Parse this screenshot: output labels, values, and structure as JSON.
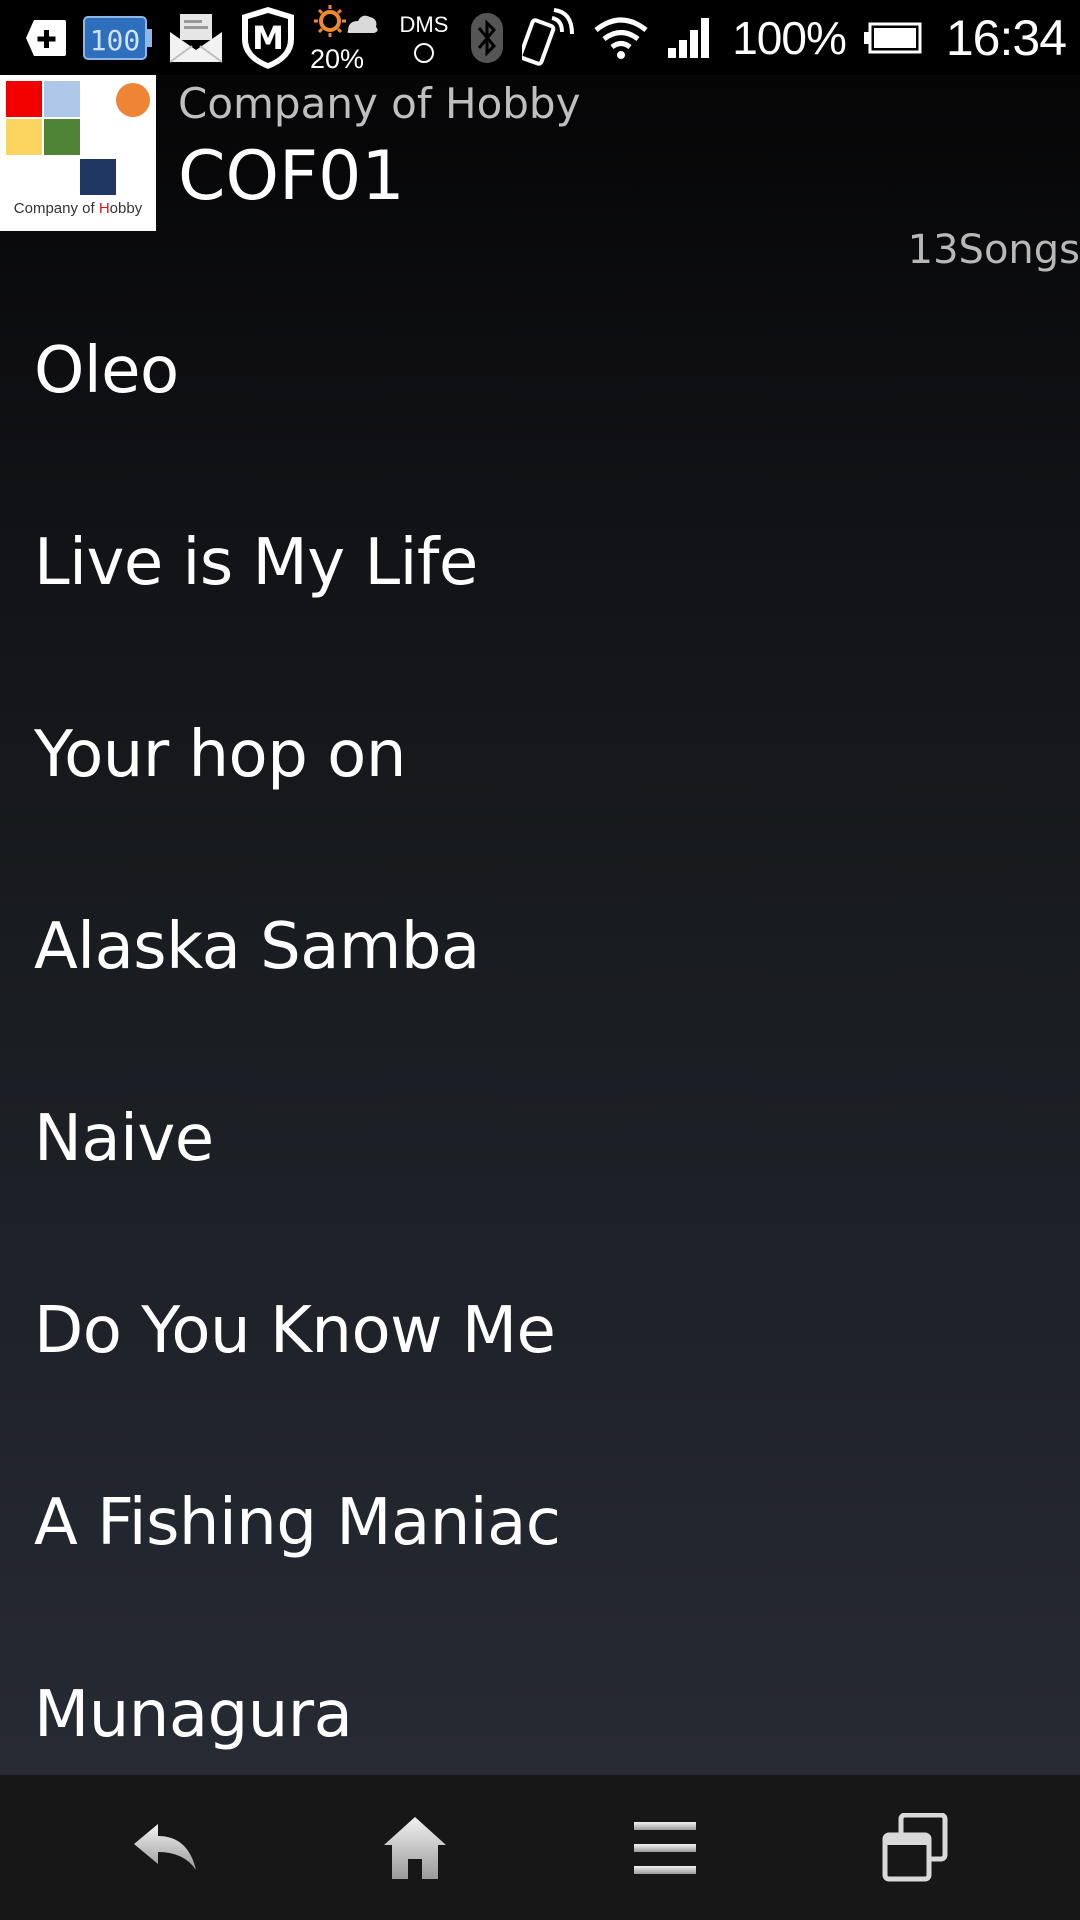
{
  "status_bar": {
    "weather_percent": "20%",
    "dms_label": "DMS",
    "battery_percent": "100%",
    "time": "16:34",
    "icons": [
      "add-icon",
      "battery-widget-icon",
      "mail-icon",
      "security-shield-icon",
      "weather-icon",
      "dms-icon",
      "bluetooth-icon",
      "nfc-phone-icon",
      "wifi-icon",
      "signal-icon",
      "battery-icon"
    ]
  },
  "header": {
    "album_art_caption_pre": "Company of ",
    "album_art_caption_h": "H",
    "album_art_caption_post": "obby",
    "artist": "Company of Hobby",
    "album": "COF01",
    "song_count": "13Songs"
  },
  "songs": [
    {
      "title": "Oleo"
    },
    {
      "title": "Live is My Life"
    },
    {
      "title": "Your hop on"
    },
    {
      "title": "Alaska Samba"
    },
    {
      "title": "Naive"
    },
    {
      "title": "Do You Know Me"
    },
    {
      "title": "A Fishing Maniac"
    },
    {
      "title": "Munagura"
    }
  ],
  "nav_bar": {
    "buttons": [
      "back-icon",
      "home-icon",
      "menu-icon",
      "recent-apps-icon"
    ]
  },
  "colors": {
    "background_top": "#050506",
    "background_bottom": "#262a33",
    "nav_bar": "#171717",
    "album_art_red": "#f20000",
    "album_art_orange": "#ee8534",
    "album_art_green": "#4f8336",
    "album_art_navy": "#1f3762"
  }
}
